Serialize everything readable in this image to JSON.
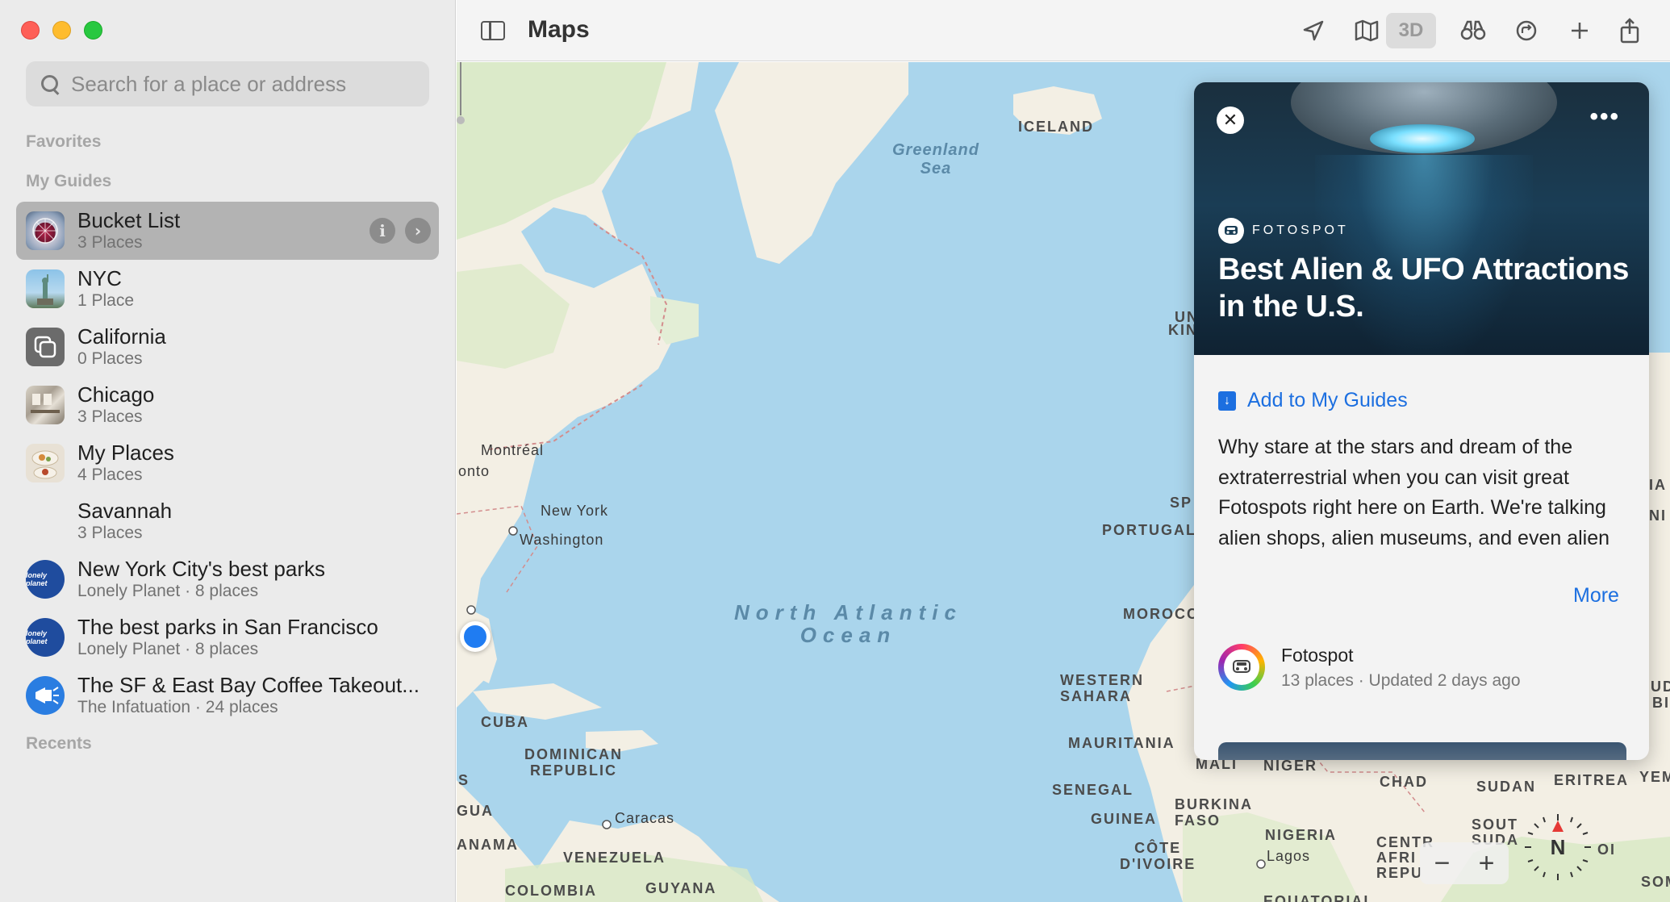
{
  "app": {
    "title": "Maps"
  },
  "search": {
    "placeholder": "Search for a place or address"
  },
  "sidebar": {
    "favorites_label": "Favorites",
    "my_guides_label": "My Guides",
    "recents_label": "Recents",
    "guides": [
      {
        "title": "Bucket List",
        "subtitle": "3 Places",
        "selected": true,
        "thumb": "ferris-wheel-photo"
      },
      {
        "title": "NYC",
        "subtitle": "1 Place",
        "thumb": "statue-of-liberty-photo"
      },
      {
        "title": "California",
        "subtitle": "0 Places",
        "thumb": "guide-stack-icon"
      },
      {
        "title": "Chicago",
        "subtitle": "3 Places",
        "thumb": "interior-photo"
      },
      {
        "title": "My Places",
        "subtitle": "4 Places",
        "thumb": "food-photo"
      },
      {
        "title": "Savannah",
        "subtitle": "3 Places",
        "thumb": "none"
      },
      {
        "title": "New York City's best parks",
        "subtitle": "Lonely Planet · 8 places",
        "thumb": "lonely-planet-logo"
      },
      {
        "title": "The best parks in San Francisco",
        "subtitle": "Lonely Planet · 8 places",
        "thumb": "lonely-planet-logo"
      },
      {
        "title": "The SF & East Bay Coffee Takeout...",
        "subtitle": "The Infatuation · 24 places",
        "thumb": "megaphone-logo"
      }
    ],
    "lonely_planet_mark": "lonely planet"
  },
  "toolbar": {
    "btn_3d": "3D",
    "icons": [
      "location-arrow-icon",
      "map-mode-icon",
      "3d-icon",
      "look-around-binoculars-icon",
      "share-eta-icon",
      "add-icon",
      "share-icon"
    ]
  },
  "map": {
    "labels": {
      "iceland": "ICELAND",
      "greenland_sea": "Greenland\nSea",
      "montreal": "Montréal",
      "toronto_partial": "onto",
      "new_york": "New York",
      "washington": "Washington",
      "ocean": "North Atlantic\nOcean",
      "portugal": "PORTUGAL",
      "spain_partial": "SP",
      "uk_partial_1": "UN",
      "uk_partial_2": "KIN",
      "morocco": "MOROCC",
      "western_sahara": "WESTERN\nSAHARA",
      "mauritania": "MAURITANIA",
      "mali": "MALI",
      "niger": "NIGER",
      "chad": "CHAD",
      "sudan": "SUDAN",
      "eritrea": "ERITREA",
      "yemen_partial": "YEM",
      "senegal": "SENEGAL",
      "guinea": "GUINEA",
      "burkina_faso": "BURKINA\nFASO",
      "nigeria": "NIGERIA",
      "lagos": "Lagos",
      "cote_divoire": "CÔTE\nD'IVOIRE",
      "car_partial": "CENTR\nAFRI\nREPU",
      "south_sudan_partial": "SOUT\nSUDA",
      "cuba": "CUBA",
      "dominican_republic": "DOMINICAN\nREPUBLIC",
      "caracas": "Caracas",
      "venezuela": "VENEZUELA",
      "guyana": "GUYANA",
      "colombia": "COLOMBIA",
      "panama_partial": "ANAMA",
      "nicaragua_partial": "GUA",
      "honduras_partial": "S",
      "equatorial_partial": "EQUATORIAL",
      "ethiopia_partial_1": "IA",
      "ethiopia_partial_2": "NI",
      "somalia_partial": "SOMA",
      "right_edge_partial_1": "UD",
      "right_edge_partial_2": "BI",
      "right_edge_partial_3": "OI"
    },
    "zoom_out": "−",
    "zoom_in": "+",
    "compass_label": "N"
  },
  "card": {
    "brand": "FOTOSPOT",
    "title": "Best Alien & UFO Attractions in the U.S.",
    "add_label": "Add to My Guides",
    "description": "Why stare at the stars and dream of the extraterrestrial when you can visit great Fotospots right here on Earth. We're talking alien shops, alien museums, and even alien jerky. (No aliens were harmed in the making of the jerky...or so...",
    "more_label": "More",
    "publisher_name": "Fotospot",
    "publisher_meta": "13 places · Updated 2 days ago",
    "close_symbol": "✕",
    "menu_symbol": "•••"
  },
  "colors": {
    "water": "#aad5ec",
    "land": "#f3efe4",
    "forest": "#d8e9c5",
    "accent_blue": "#1c6fe0",
    "location_blue": "#1f7cf2"
  }
}
